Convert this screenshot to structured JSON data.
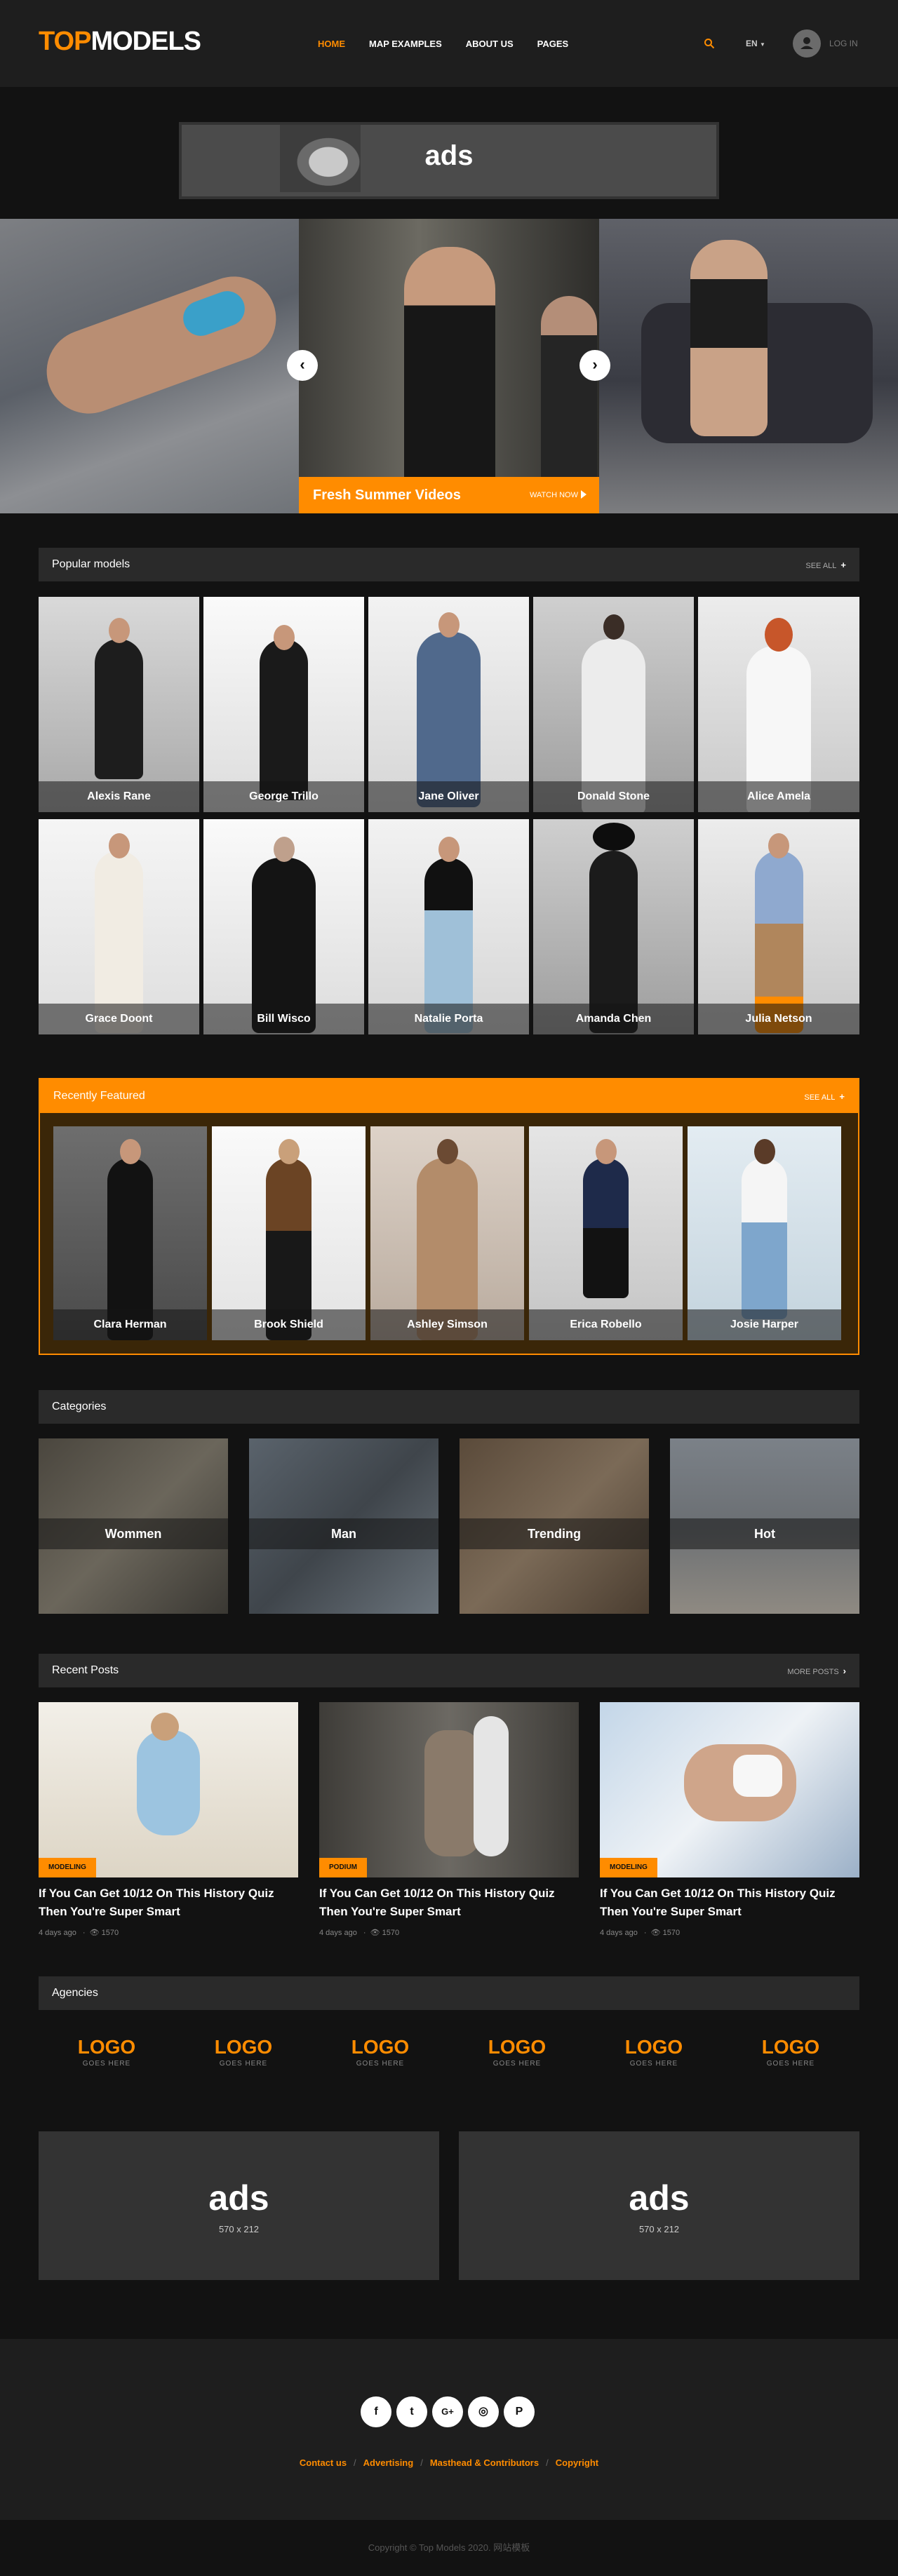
{
  "header": {
    "logo_a": "TOP",
    "logo_b": "MODELS",
    "nav": [
      "HOME",
      "MAP EXAMPLES",
      "ABOUT US",
      "PAGES"
    ],
    "lang": "EN",
    "login": "LOG IN"
  },
  "ad_top": {
    "title": "ads"
  },
  "slider": {
    "caption": "Fresh Summer Videos",
    "watch": "WATCH NOW"
  },
  "popular": {
    "title": "Popular models",
    "see_all": "SEE ALL",
    "models": [
      "Alexis Rane",
      "George Trillo",
      "Jane Oliver",
      "Donald Stone",
      "Alice Amela",
      "Grace Doont",
      "Bill Wisco",
      "Natalie Porta",
      "Amanda Chen",
      "Julia Netson"
    ]
  },
  "featured": {
    "title": "Recently Featured",
    "see_all": "SEE ALL",
    "models": [
      "Clara Herman",
      "Brook Shield",
      "Ashley Simson",
      "Erica Robello",
      "Josie Harper"
    ]
  },
  "categories": {
    "title": "Categories",
    "items": [
      "Wommen",
      "Man",
      "Trending",
      "Hot"
    ]
  },
  "posts": {
    "title": "Recent Posts",
    "more": "MORE POSTS",
    "items": [
      {
        "tag": "MODELING",
        "title": "If You Can Get 10/12 On This History Quiz Then You're Super Smart",
        "date": "4 days ago",
        "views": "1570"
      },
      {
        "tag": "PODIUM",
        "title": "If You Can Get 10/12 On This History Quiz Then You're Super Smart",
        "date": "4 days ago",
        "views": "1570"
      },
      {
        "tag": "MODELING",
        "title": "If You Can Get 10/12 On This History Quiz Then You're Super Smart",
        "date": "4 days ago",
        "views": "1570"
      }
    ]
  },
  "agencies": {
    "title": "Agencies",
    "logo": "LOGO",
    "sub": "GOES HERE"
  },
  "ads": [
    {
      "title": "ads",
      "size": "570 x 212"
    },
    {
      "title": "ads",
      "size": "570 x 212"
    }
  ],
  "footer": {
    "social": [
      "f",
      "t",
      "G+",
      "◎",
      "P"
    ],
    "links": [
      "Contact us",
      "Advertising",
      "Masthead & Contributors",
      "Copyright"
    ],
    "copyright": "Copyright © Top Models 2020. 网站模板"
  },
  "colors": {
    "accent": "#ff8c00",
    "bg": "#121212",
    "panel": "#2a2a2a"
  }
}
